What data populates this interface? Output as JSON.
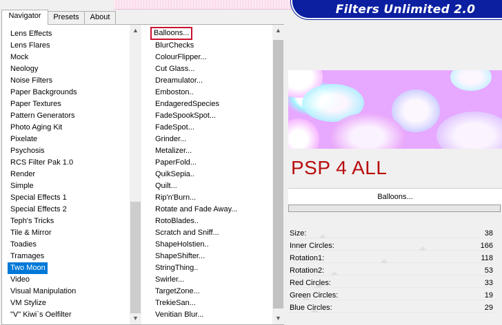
{
  "app": {
    "brand": "Filters Unlimited 2.0"
  },
  "tabs": [
    {
      "label": "Navigator",
      "active": true
    },
    {
      "label": "Presets",
      "active": false
    },
    {
      "label": "About",
      "active": false
    }
  ],
  "categories": [
    "Lens Effects",
    "Lens Flares",
    "Mock",
    "Neology",
    "Noise Filters",
    "Paper Backgrounds",
    "Paper Textures",
    "Pattern Generators",
    "Photo Aging Kit",
    "Pixelate",
    "Psychosis",
    "RCS Filter Pak 1.0",
    "Render",
    "Simple",
    "Special Effects 1",
    "Special Effects 2",
    "Teph's Tricks",
    "Tile & Mirror",
    "Toadies",
    "Tramages",
    "Two Moon",
    "Video",
    "Visual Manipulation",
    "VM Stylize",
    "\"V\" Kiwi`s Oelfilter"
  ],
  "selected_category": "Two Moon",
  "filters": [
    "Balloons...",
    "BlurChecks",
    "ColourFlipper...",
    "Cut Glass...",
    "Dreamulator...",
    "Emboston..",
    "EndageredSpecies",
    "FadeSpookSpot...",
    "FadeSpot...",
    "Grinder...",
    "Metalizer...",
    "PaperFold...",
    "QuikSepia..",
    "Quilt...",
    "Rip'n'Burn...",
    "Rotate and Fade Away...",
    "RotoBlades..",
    "Scratch and Sniff...",
    "ShapeHolstien..",
    "ShapeShifter...",
    "StringThing..",
    "Swirler...",
    "TargetZone...",
    "TrekieSan...",
    "Venitian Blur..."
  ],
  "selected_filter": "Balloons...",
  "logo_text": "PSP 4 ALL",
  "current_filter": "Balloons...",
  "params": [
    {
      "label": "Size:",
      "value": "38",
      "level": 0.15
    },
    {
      "label": "Inner Circles:",
      "value": "166",
      "level": 0.65
    },
    {
      "label": "Rotation1:",
      "value": "118",
      "level": 0.46
    },
    {
      "label": "Rotation2:",
      "value": "53",
      "level": 0.21
    },
    {
      "label": "Red Circles:",
      "value": "33",
      "level": 0.13
    },
    {
      "label": "Green Circles:",
      "value": "19",
      "level": 0.07
    },
    {
      "label": "Blue Circles:",
      "value": "29",
      "level": 0.11
    }
  ],
  "colors": {
    "accent": "#0078d7",
    "brand_bg": "#0b1fa0",
    "logo": "#b80d0d",
    "focus": "#c8102e"
  }
}
